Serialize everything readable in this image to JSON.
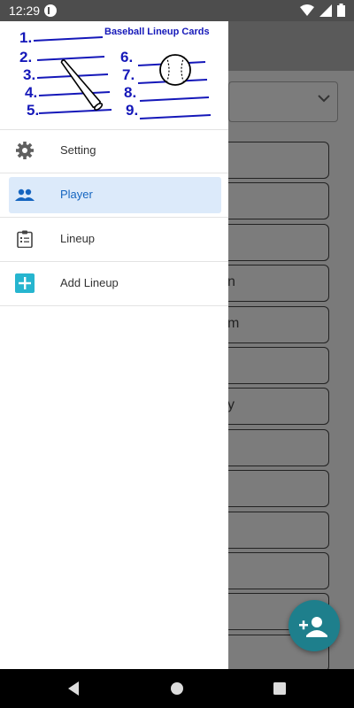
{
  "status_bar": {
    "time": "12:29",
    "icons": [
      "app-notification-icon",
      "wifi-icon",
      "signal-icon",
      "battery-icon"
    ]
  },
  "drawer": {
    "header_title": "Baseball Lineup Cards",
    "lineup_numbers": [
      "1.",
      "2.",
      "3.",
      "4.",
      "5.",
      "6.",
      "7.",
      "8.",
      "9."
    ],
    "items": [
      {
        "label": "Setting",
        "icon": "gear-icon",
        "active": false
      },
      {
        "label": "Player",
        "icon": "people-icon",
        "active": true
      },
      {
        "label": "Lineup",
        "icon": "clipboard-icon",
        "active": false
      },
      {
        "label": "Add Lineup",
        "icon": "add-box-icon",
        "active": false
      }
    ]
  },
  "background": {
    "row_fragments": [
      "",
      "",
      "",
      "n",
      "m",
      "",
      "y",
      "",
      "",
      "",
      "",
      "",
      ""
    ]
  },
  "fab": {
    "icon": "person-add-icon"
  },
  "colors": {
    "accent": "#1565c0",
    "active_bg": "#dceafa",
    "fab": "#1e7f8c",
    "logo_blue": "#1518b9",
    "add_icon": "#26b5cf"
  }
}
